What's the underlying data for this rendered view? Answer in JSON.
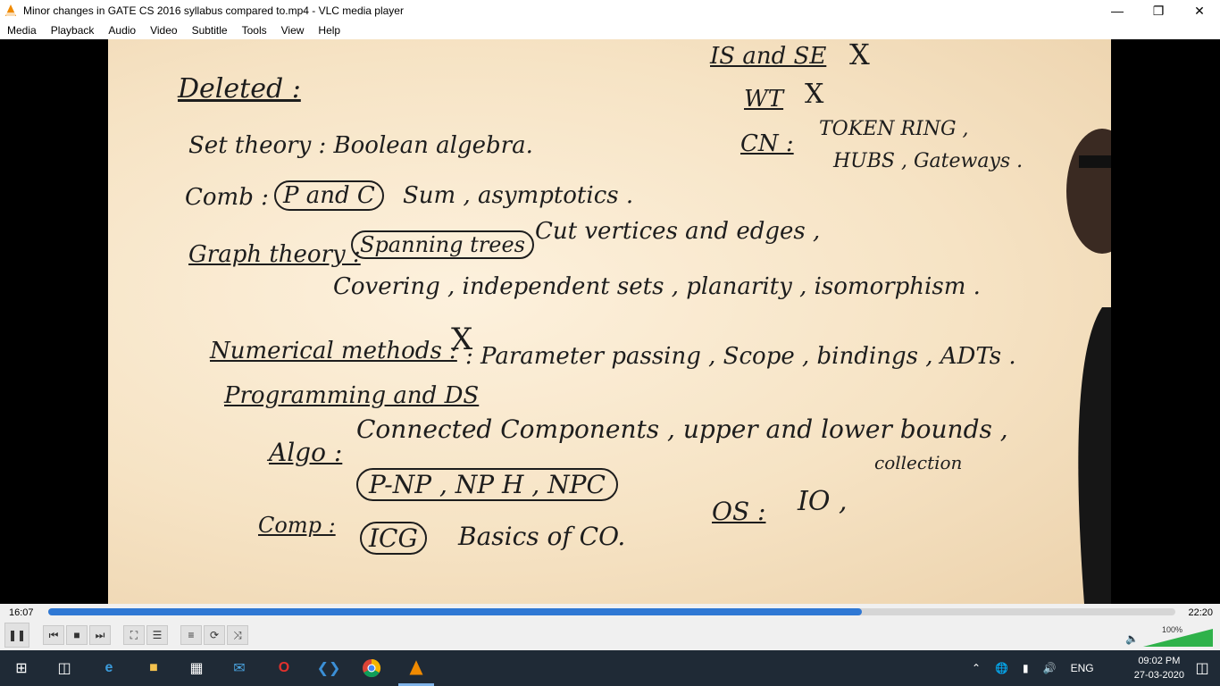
{
  "window": {
    "title": "Minor changes in GATE CS 2016 syllabus compared to.mp4 - VLC media player"
  },
  "menu": [
    "Media",
    "Playback",
    "Audio",
    "Video",
    "Subtitle",
    "Tools",
    "View",
    "Help"
  ],
  "board": {
    "deleted": "Deleted :",
    "set_theory": "Set theory : Boolean algebra.",
    "comb_label": "Comb :",
    "comb_circ": "P and C",
    "comb_rest": "Sum , asymptotics .",
    "graph_label": "Graph theory :",
    "graph_circ": "Spanning trees",
    "graph_rest": "Cut vertices and edges ,",
    "graph_line2": "Covering , independent sets , planarity , isomorphism .",
    "numerical": "Numerical methods :",
    "numerical_mark": "X",
    "prog_label": "Programming and DS",
    "prog_rest": ": Parameter passing , Scope , bindings , ADTs .",
    "algo_label": "Algo :",
    "algo_rest": "Connected Components , upper and lower bounds ,",
    "algo_circ": "P-NP , NP H , NPC",
    "comp_label": "Comp :",
    "comp_circ": "ICG",
    "comp_rest": "Basics of CO.",
    "os_label": "OS :",
    "os_rest": "IO ,",
    "collection": "collection",
    "is_se": "IS and SE",
    "is_se_mark": "X",
    "wt": "WT",
    "wt_mark": "X",
    "cn": "CN :",
    "cn_rest1": "TOKEN RING ,",
    "cn_rest2": "HUBS , Gateways ."
  },
  "player": {
    "elapsed": "16:07",
    "total": "22:20",
    "progress_fraction": 0.722,
    "volume_label": "100%"
  },
  "taskbar": {
    "lang": "ENG",
    "time": "09:02 PM",
    "date": "27-03-2020"
  }
}
